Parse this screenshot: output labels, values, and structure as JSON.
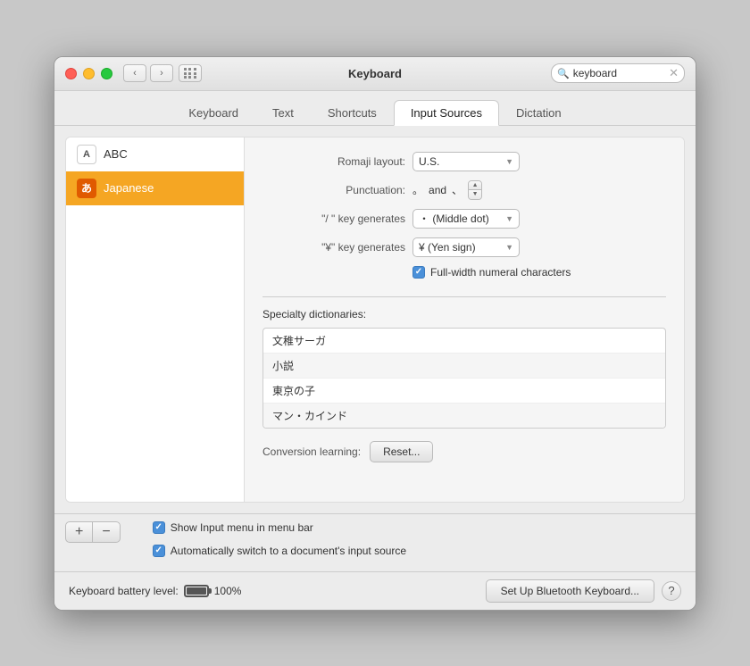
{
  "window": {
    "title": "Keyboard"
  },
  "titlebar": {
    "back_label": "‹",
    "forward_label": "›",
    "search_placeholder": "keyboard",
    "search_clear_label": "✕"
  },
  "tabs": [
    {
      "id": "keyboard",
      "label": "Keyboard"
    },
    {
      "id": "text",
      "label": "Text"
    },
    {
      "id": "shortcuts",
      "label": "Shortcuts"
    },
    {
      "id": "input_sources",
      "label": "Input Sources",
      "active": true
    },
    {
      "id": "dictation",
      "label": "Dictation"
    }
  ],
  "sidebar": {
    "items": [
      {
        "id": "abc",
        "icon": "A",
        "label": "ABC",
        "selected": false
      },
      {
        "id": "japanese",
        "icon": "あ",
        "label": "Japanese",
        "selected": true
      }
    ]
  },
  "settings": {
    "romaji_label": "Romaji layout:",
    "romaji_value": "U.S.",
    "punctuation_label": "Punctuation:",
    "punctuation_value": "。",
    "punctuation_and": "and",
    "punctuation_value2": "、",
    "slash_label": "\"/ \" key generates",
    "slash_value": "・ (Middle dot)",
    "yen_label": "\"¥\" key generates",
    "yen_value": "¥ (Yen sign)",
    "fullwidth_label": "Full-width numeral characters",
    "specialty_label": "Specialty dictionaries:",
    "dictionaries": [
      {
        "id": 1,
        "text": "文稚サーガ"
      },
      {
        "id": 2,
        "text": "小説"
      },
      {
        "id": 3,
        "text": "東京の子"
      },
      {
        "id": 4,
        "text": "マン・カインド"
      }
    ],
    "conversion_label": "Conversion learning:",
    "reset_label": "Reset..."
  },
  "bottom": {
    "add_label": "+",
    "remove_label": "−",
    "show_menu_label": "Show Input menu in menu bar",
    "auto_switch_label": "Automatically switch to a document's input source"
  },
  "footer": {
    "battery_label": "Keyboard battery level:",
    "battery_percent": "100%",
    "setup_btn_label": "Set Up Bluetooth Keyboard...",
    "help_label": "?"
  }
}
